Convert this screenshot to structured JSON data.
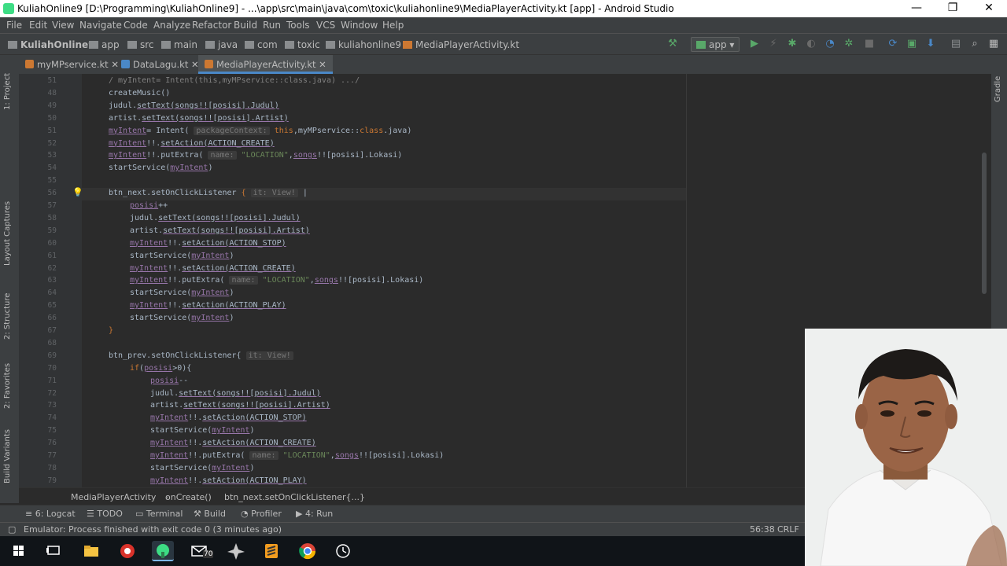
{
  "window": {
    "title": "KuliahOnline9 [D:\\Programming\\KuliahOnline9] - ...\\app\\src\\main\\java\\com\\toxic\\kuliahonline9\\MediaPlayerActivity.kt [app] - Android Studio",
    "minimize": "—",
    "restore": "❐",
    "close": "✕"
  },
  "menu": [
    "File",
    "Edit",
    "View",
    "Navigate",
    "Code",
    "Analyze",
    "Refactor",
    "Build",
    "Run",
    "Tools",
    "VCS",
    "Window",
    "Help"
  ],
  "nav": {
    "crumbs": [
      "KuliahOnline9",
      "app",
      "src",
      "main",
      "java",
      "com",
      "toxic",
      "kuliahonline9",
      "MediaPlayerActivity.kt"
    ],
    "run_config": "app"
  },
  "tabs": [
    "myMPservice.kt",
    "DataLagu.kt",
    "MediaPlayerActivity.kt"
  ],
  "left_tools": [
    "1: Project",
    "Layout Captures",
    "2: Structure",
    "2: Favorites",
    "Build Variants"
  ],
  "right_tools": [
    "Gradle"
  ],
  "line_numbers": [
    "51",
    "48",
    "49",
    "50",
    "51",
    "52",
    "53",
    "54",
    "55",
    "56",
    "57",
    "58",
    "59",
    "60",
    "61",
    "62",
    "63",
    "64",
    "65",
    "66",
    "67",
    "68",
    "69",
    "70",
    "71",
    "72",
    "73",
    "74",
    "75",
    "76",
    "77",
    "78",
    "79"
  ],
  "code": [
    {
      "indent": 0,
      "parts": [
        {
          "t": "/ myIntent= Intent(this,myMPservice::class.java) .../",
          "c": "#808080"
        }
      ]
    },
    {
      "indent": 0,
      "parts": [
        {
          "t": "createMusic()"
        }
      ]
    },
    {
      "indent": 0,
      "parts": [
        {
          "t": "judul."
        },
        {
          "t": "setText(songs!![posisi].Judul)",
          "u": 1
        }
      ]
    },
    {
      "indent": 0,
      "parts": [
        {
          "t": "artist."
        },
        {
          "t": "setText(songs!![posisi].Artist)",
          "u": 1
        }
      ]
    },
    {
      "indent": 0,
      "parts": [
        {
          "t": "myIntent",
          "c": "#9876aa",
          "u": 1
        },
        {
          "t": "= Intent( "
        },
        {
          "t": "packageContext:",
          "h": 1
        },
        {
          "t": " this",
          "c": "#cc7832"
        },
        {
          "t": ",myMPservice::"
        },
        {
          "t": "class",
          "c": "#cc7832"
        },
        {
          "t": ".java)"
        }
      ]
    },
    {
      "indent": 0,
      "parts": [
        {
          "t": "myIntent",
          "c": "#9876aa",
          "u": 1
        },
        {
          "t": "!!."
        },
        {
          "t": "setAction(ACTION_CREATE)",
          "u": 1
        }
      ]
    },
    {
      "indent": 0,
      "parts": [
        {
          "t": "myIntent",
          "c": "#9876aa",
          "u": 1
        },
        {
          "t": "!!.putExtra( "
        },
        {
          "t": "name:",
          "h": 1
        },
        {
          "t": " \"LOCATION\"",
          "c": "#6a8759"
        },
        {
          "t": ","
        },
        {
          "t": "songs",
          "c": "#9876aa",
          "u": 1
        },
        {
          "t": "!![posisi].Lokasi)"
        }
      ]
    },
    {
      "indent": 0,
      "parts": [
        {
          "t": "startService("
        },
        {
          "t": "myIntent",
          "c": "#9876aa",
          "u": 1
        },
        {
          "t": ")"
        }
      ]
    },
    {
      "indent": 0,
      "parts": [
        {
          "t": ""
        }
      ]
    },
    {
      "indent": 0,
      "parts": [
        {
          "t": "btn_next.setOnClickListener "
        },
        {
          "t": "{",
          "c": "#cc7832"
        },
        {
          "t": " "
        },
        {
          "t": "it: View!",
          "h": 1
        },
        {
          "t": " |"
        }
      ]
    },
    {
      "indent": 1,
      "parts": [
        {
          "t": "posisi",
          "c": "#9876aa",
          "u": 1
        },
        {
          "t": "++"
        }
      ]
    },
    {
      "indent": 1,
      "parts": [
        {
          "t": "judul."
        },
        {
          "t": "setText(songs!![posisi].Judul)",
          "u": 1
        }
      ]
    },
    {
      "indent": 1,
      "parts": [
        {
          "t": "artist."
        },
        {
          "t": "setText(songs!![posisi].Artist)",
          "u": 1
        }
      ]
    },
    {
      "indent": 1,
      "parts": [
        {
          "t": "myIntent",
          "c": "#9876aa",
          "u": 1
        },
        {
          "t": "!!."
        },
        {
          "t": "setAction(ACTION_STOP)",
          "u": 1
        }
      ]
    },
    {
      "indent": 1,
      "parts": [
        {
          "t": "startService("
        },
        {
          "t": "myIntent",
          "c": "#9876aa",
          "u": 1
        },
        {
          "t": ")"
        }
      ]
    },
    {
      "indent": 1,
      "parts": [
        {
          "t": "myIntent",
          "c": "#9876aa",
          "u": 1
        },
        {
          "t": "!!."
        },
        {
          "t": "setAction(ACTION_CREATE)",
          "u": 1
        }
      ]
    },
    {
      "indent": 1,
      "parts": [
        {
          "t": "myIntent",
          "c": "#9876aa",
          "u": 1
        },
        {
          "t": "!!.putExtra( "
        },
        {
          "t": "name:",
          "h": 1
        },
        {
          "t": " \"LOCATION\"",
          "c": "#6a8759"
        },
        {
          "t": ","
        },
        {
          "t": "songs",
          "c": "#9876aa",
          "u": 1
        },
        {
          "t": "!![posisi].Lokasi)"
        }
      ]
    },
    {
      "indent": 1,
      "parts": [
        {
          "t": "startService("
        },
        {
          "t": "myIntent",
          "c": "#9876aa",
          "u": 1
        },
        {
          "t": ")"
        }
      ]
    },
    {
      "indent": 1,
      "parts": [
        {
          "t": "myIntent",
          "c": "#9876aa",
          "u": 1
        },
        {
          "t": "!!."
        },
        {
          "t": "setAction(ACTION_PLAY)",
          "u": 1
        }
      ]
    },
    {
      "indent": 1,
      "parts": [
        {
          "t": "startService("
        },
        {
          "t": "myIntent",
          "c": "#9876aa",
          "u": 1
        },
        {
          "t": ")"
        }
      ]
    },
    {
      "indent": 0,
      "parts": [
        {
          "t": "}",
          "c": "#cc7832"
        }
      ]
    },
    {
      "indent": 0,
      "parts": [
        {
          "t": ""
        }
      ]
    },
    {
      "indent": 0,
      "parts": [
        {
          "t": "btn_prev.setOnClickListener{ "
        },
        {
          "t": "it: View!",
          "h": 1
        }
      ]
    },
    {
      "indent": 1,
      "parts": [
        {
          "t": "if",
          "c": "#cc7832"
        },
        {
          "t": "("
        },
        {
          "t": "posisi",
          "c": "#9876aa",
          "u": 1
        },
        {
          "t": ">0){"
        }
      ]
    },
    {
      "indent": 2,
      "parts": [
        {
          "t": "posisi",
          "c": "#9876aa",
          "u": 1
        },
        {
          "t": "--"
        }
      ]
    },
    {
      "indent": 2,
      "parts": [
        {
          "t": "judul."
        },
        {
          "t": "setText(songs!![posisi].Judul)",
          "u": 1
        }
      ]
    },
    {
      "indent": 2,
      "parts": [
        {
          "t": "artist."
        },
        {
          "t": "setText(songs!![posisi].Artist)",
          "u": 1
        }
      ]
    },
    {
      "indent": 2,
      "parts": [
        {
          "t": "myIntent",
          "c": "#9876aa",
          "u": 1
        },
        {
          "t": "!!."
        },
        {
          "t": "setAction(ACTION_STOP)",
          "u": 1
        }
      ]
    },
    {
      "indent": 2,
      "parts": [
        {
          "t": "startService("
        },
        {
          "t": "myIntent",
          "c": "#9876aa",
          "u": 1
        },
        {
          "t": ")"
        }
      ]
    },
    {
      "indent": 2,
      "parts": [
        {
          "t": "myIntent",
          "c": "#9876aa",
          "u": 1
        },
        {
          "t": "!!."
        },
        {
          "t": "setAction(ACTION_CREATE)",
          "u": 1
        }
      ]
    },
    {
      "indent": 2,
      "parts": [
        {
          "t": "myIntent",
          "c": "#9876aa",
          "u": 1
        },
        {
          "t": "!!.putExtra( "
        },
        {
          "t": "name:",
          "h": 1
        },
        {
          "t": " \"LOCATION\"",
          "c": "#6a8759"
        },
        {
          "t": ","
        },
        {
          "t": "songs",
          "c": "#9876aa",
          "u": 1
        },
        {
          "t": "!![posisi].Lokasi)"
        }
      ]
    },
    {
      "indent": 2,
      "parts": [
        {
          "t": "startService("
        },
        {
          "t": "myIntent",
          "c": "#9876aa",
          "u": 1
        },
        {
          "t": ")"
        }
      ]
    },
    {
      "indent": 2,
      "parts": [
        {
          "t": "myIntent",
          "c": "#9876aa",
          "u": 1
        },
        {
          "t": "!!."
        },
        {
          "t": "setAction(ACTION_PLAY)",
          "u": 1
        }
      ]
    }
  ],
  "editor_breadcrumb": [
    "MediaPlayerActivity",
    "onCreate()",
    "btn_next.setOnClickListener{...}"
  ],
  "tool_windows": [
    "6: Logcat",
    "TODO",
    "Terminal",
    "Build",
    "Profiler",
    "4: Run"
  ],
  "status": {
    "message": "Emulator: Process finished with exit code 0 (3 minutes ago)",
    "position": "56:38",
    "line_sep": "CRLF"
  },
  "taskbar": {
    "badge": "70"
  },
  "colors": {
    "editor_bg": "#2b2b2b",
    "chrome_bg": "#3c3f41",
    "keyword": "#cc7832",
    "string": "#6a8759",
    "field": "#9876aa",
    "run_green": "#59a869"
  }
}
